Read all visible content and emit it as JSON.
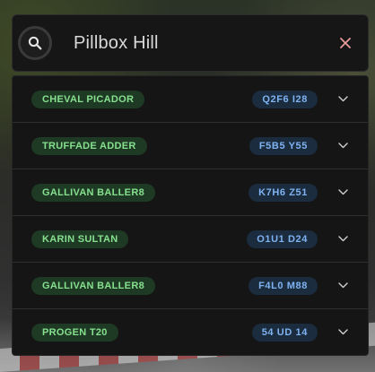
{
  "search": {
    "query": "Pillbox Hill"
  },
  "results": [
    {
      "vehicle": "CHEVAL PICADOR",
      "plate": "Q2F6 I28"
    },
    {
      "vehicle": "TRUFFADE ADDER",
      "plate": "F5B5 Y55"
    },
    {
      "vehicle": "GALLIVAN BALLER8",
      "plate": "K7H6 Z51"
    },
    {
      "vehicle": "KARIN SULTAN",
      "plate": "O1U1 D24"
    },
    {
      "vehicle": "GALLIVAN BALLER8",
      "plate": "F4L0 M88"
    },
    {
      "vehicle": "PROGEN T20",
      "plate": "54 UD 14"
    }
  ],
  "icons": {
    "search": "search-icon",
    "clear": "close-icon",
    "expand": "chevron-down-icon"
  },
  "colors": {
    "vehicle_badge_bg": "#1e3a25",
    "vehicle_badge_text": "#86e08e",
    "plate_badge_bg": "#1b2c3f",
    "plate_badge_text": "#7fb2f0",
    "clear_icon": "#e79a9a"
  }
}
